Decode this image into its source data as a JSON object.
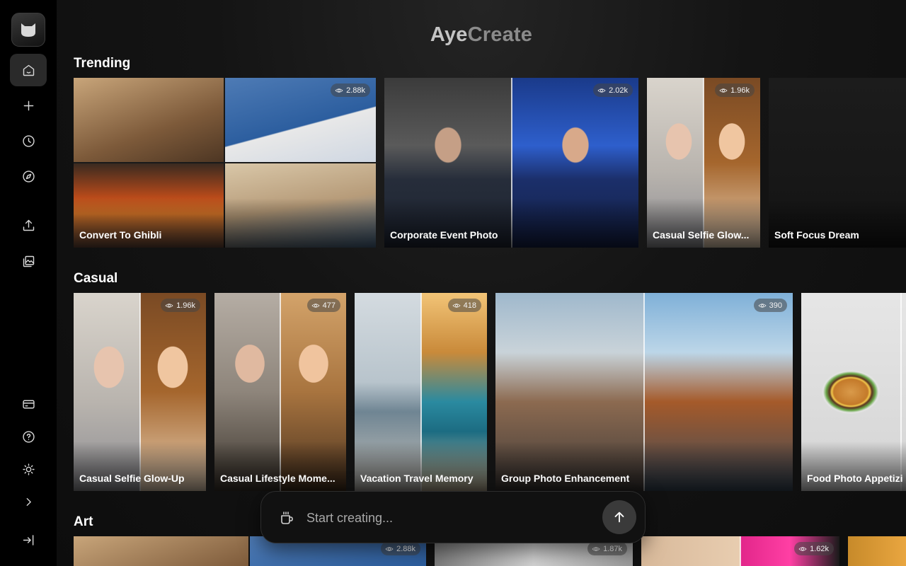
{
  "brand": {
    "part1": "Aye",
    "part2": "Create"
  },
  "sidebar": {
    "logo_icon": "cat-icon",
    "top": [
      {
        "name": "home",
        "icon": "home-icon",
        "active": true
      },
      {
        "name": "create",
        "icon": "plus-icon"
      },
      {
        "name": "history",
        "icon": "clock-icon"
      },
      {
        "name": "explore",
        "icon": "compass-icon"
      },
      {
        "name": "upload",
        "icon": "upload-icon"
      },
      {
        "name": "gallery",
        "icon": "image-gallery-icon"
      }
    ],
    "bottom": [
      {
        "name": "billing",
        "icon": "credit-card-icon"
      },
      {
        "name": "help",
        "icon": "help-circle-icon"
      },
      {
        "name": "theme",
        "icon": "sun-icon"
      },
      {
        "name": "expand",
        "icon": "chevron-right-icon"
      },
      {
        "name": "logout",
        "icon": "logout-icon"
      }
    ]
  },
  "sections": {
    "trending": {
      "title": "Trending",
      "cards": [
        {
          "label": "Convert To Ghibli",
          "views": "2.88k"
        },
        {
          "label": "Corporate Event Photo",
          "views": "2.02k"
        },
        {
          "label": "Casual Selfie Glow...",
          "views": "1.96k"
        },
        {
          "label": "Soft Focus Dream",
          "views": ""
        }
      ]
    },
    "casual": {
      "title": "Casual",
      "cards": [
        {
          "label": "Casual Selfie Glow-Up",
          "views": "1.96k"
        },
        {
          "label": "Casual Lifestyle Mome...",
          "views": "477"
        },
        {
          "label": "Vacation Travel Memory",
          "views": "418"
        },
        {
          "label": "Group Photo Enhancement",
          "views": "390"
        },
        {
          "label": "Food Photo Appetizi",
          "views": ""
        }
      ]
    },
    "art": {
      "title": "Art",
      "cards": [
        {
          "label": "",
          "views": "2.88k"
        },
        {
          "label": "",
          "views": "1.87k"
        },
        {
          "label": "",
          "views": "1.62k"
        },
        {
          "label": "",
          "views": ""
        }
      ]
    }
  },
  "prompt": {
    "placeholder": "Start creating...",
    "icon": "coffee-cup-icon",
    "send_icon": "arrow-up-icon"
  }
}
